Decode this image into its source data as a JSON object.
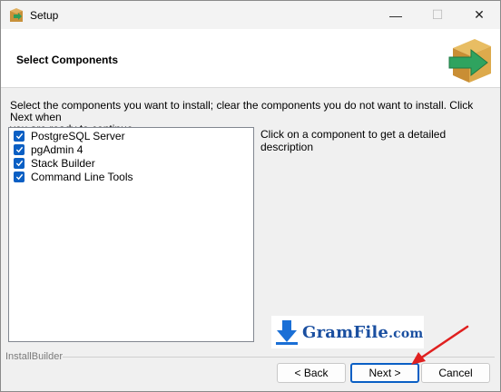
{
  "window": {
    "title": "Setup",
    "controls": {
      "minimize": "—",
      "maximize": "☐",
      "close": "✕"
    }
  },
  "header": {
    "title": "Select Components"
  },
  "body": {
    "instructions_line1": "Select the components you want to install; clear the components you do not want to install. Click Next when",
    "instructions_line2": "you are ready to continue.",
    "components": [
      {
        "label": "PostgreSQL Server",
        "checked": true
      },
      {
        "label": "pgAdmin 4",
        "checked": true
      },
      {
        "label": "Stack Builder",
        "checked": true
      },
      {
        "label": "Command Line Tools",
        "checked": true
      }
    ],
    "description": "Click on a component to get a detailed description"
  },
  "watermark": {
    "main": "GramFile",
    "suffix": ".com"
  },
  "footer": {
    "brand": "InstallBuilder",
    "back_label": "< Back",
    "next_label": "Next >",
    "cancel_label": "Cancel"
  },
  "colors": {
    "accent": "#0a5fc4",
    "annotation_arrow": "#e0201f"
  },
  "icons": {
    "app": "installer-box-icon",
    "header": "installer-box-arrow-icon",
    "checkbox": "checkmark-icon",
    "watermark": "download-arrow-icon"
  }
}
